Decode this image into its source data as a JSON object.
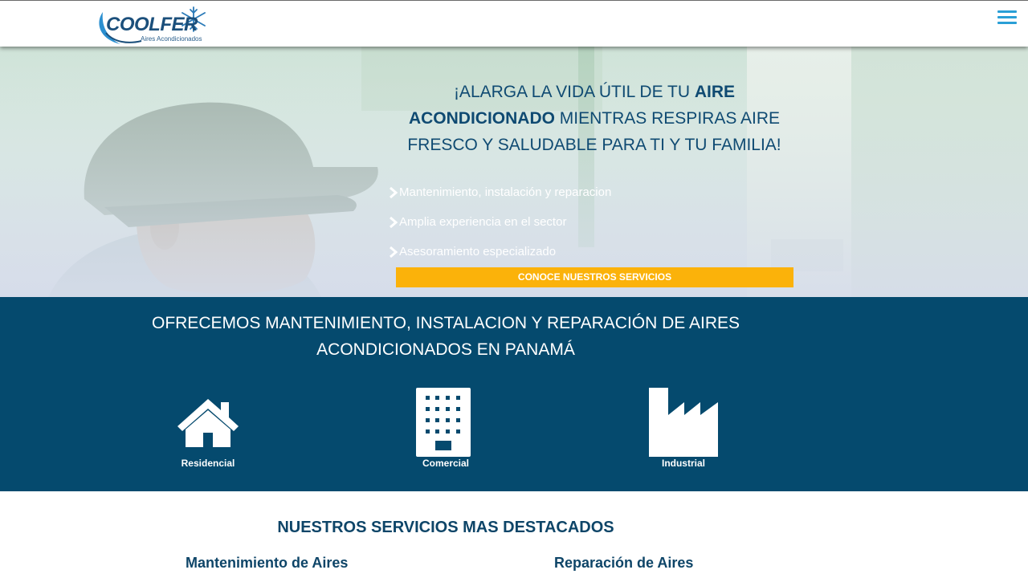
{
  "header": {
    "logo_word": "COOLFER",
    "logo_tagline": "Aires Acondicionados",
    "menu_icon": "hamburger-menu-icon"
  },
  "hero": {
    "headline_pre": "¡ALARGA LA VIDA ÚTIL DE TU ",
    "headline_bold": "AIRE ACONDICIONADO",
    "headline_post": " MIENTRAS RESPIRAS AIRE FRESCO Y SALUDABLE PARA TI Y TU FAMILIA!",
    "features": [
      "Mantenimiento, instalación y reparacion",
      "Amplia experiencia en el sector",
      "Asesoramiento especializado"
    ],
    "cta_label": "CONOCE NUESTROS SERVICIOS"
  },
  "offer": {
    "title_line1": "OFRECEMOS MANTENIMIENTO, INSTALACION Y REPARACIÓN DE AIRES",
    "title_line2": "ACONDICIONADOS EN PANAMÁ",
    "categories": [
      {
        "label": "Residencial",
        "icon": "house-icon"
      },
      {
        "label": "Comercial",
        "icon": "building-icon"
      },
      {
        "label": "Industrial",
        "icon": "factory-icon"
      }
    ]
  },
  "services": {
    "title": "NUESTROS SERVICIOS MAS DESTACADOS",
    "items": [
      "Mantenimiento de Aires",
      "Reparación de Aires"
    ]
  },
  "colors": {
    "accent_blue": "#054a6e",
    "cta_orange": "#fbb20a",
    "menu_blue": "#2a9fd6",
    "heading_blue": "#0e4568"
  }
}
